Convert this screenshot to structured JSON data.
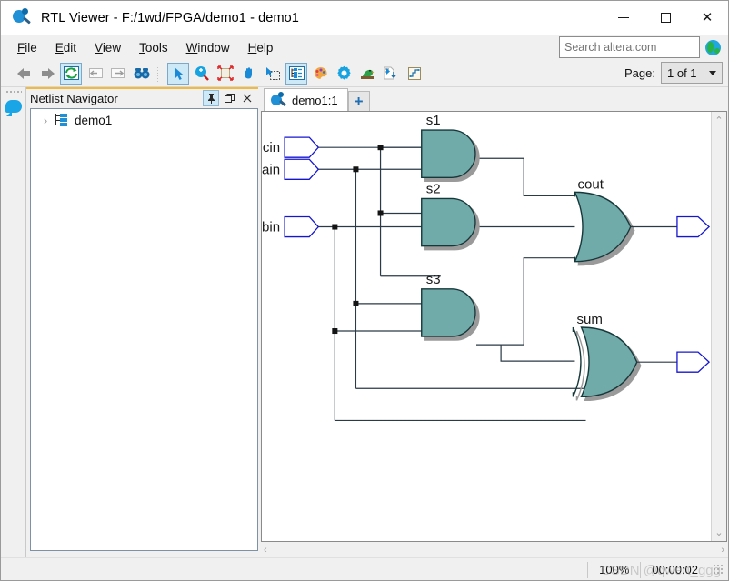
{
  "window": {
    "title": "RTL Viewer - F:/1wd/FPGA/demo1 - demo1",
    "app_icon": "rtl-viewer-icon",
    "minimize_label": "—",
    "maximize_label": "□",
    "close_label": "✕"
  },
  "menu": {
    "items": [
      {
        "label": "File",
        "accel": "F"
      },
      {
        "label": "Edit",
        "accel": "E"
      },
      {
        "label": "View",
        "accel": "V"
      },
      {
        "label": "Tools",
        "accel": "T"
      },
      {
        "label": "Window",
        "accel": "W"
      },
      {
        "label": "Help",
        "accel": "H"
      }
    ]
  },
  "search": {
    "value": "",
    "placeholder": "Search altera.com",
    "icon": "globe-icon"
  },
  "toolbar": {
    "group1": [
      {
        "name": "back-icon",
        "glyph": "⬅",
        "enabled": false,
        "selected": false
      },
      {
        "name": "forward-icon",
        "glyph": "➡",
        "enabled": false,
        "selected": false
      },
      {
        "name": "refresh-icon",
        "glyph": "↺",
        "enabled": true,
        "selected": false
      },
      {
        "name": "previous-page-icon",
        "glyph": "←",
        "enabled": false,
        "selected": false
      },
      {
        "name": "next-page-icon",
        "glyph": "→",
        "enabled": false,
        "selected": false
      },
      {
        "name": "find-icon",
        "glyph": "◉◉",
        "enabled": true,
        "selected": false
      }
    ],
    "group2": [
      {
        "name": "select-tool-icon",
        "glyph": "⬈",
        "selected": true
      },
      {
        "name": "zoom-tool-icon",
        "glyph": "⌕",
        "selected": false
      },
      {
        "name": "fit-in-window-icon",
        "glyph": "⤡",
        "selected": false
      },
      {
        "name": "hand-pan-tool-icon",
        "glyph": "✋",
        "selected": false
      },
      {
        "name": "area-select-tool-icon",
        "glyph": "⬚",
        "selected": false
      },
      {
        "name": "netlist-navigator-icon",
        "glyph": "☰",
        "selected": true
      },
      {
        "name": "color-palette-icon",
        "glyph": "◕",
        "selected": false
      },
      {
        "name": "settings-gear-icon",
        "glyph": "⚙",
        "selected": false
      },
      {
        "name": "bird-probe-icon",
        "glyph": "▶",
        "selected": false
      },
      {
        "name": "export-netlist-icon",
        "glyph": "⬇",
        "selected": false
      },
      {
        "name": "schematic-export-icon",
        "glyph": "☰",
        "selected": false
      }
    ]
  },
  "page_control": {
    "label": "Page:",
    "value": "1 of 1"
  },
  "left_strip": {
    "bubble_icon": "message-bubble-icon"
  },
  "nav_panel": {
    "title": "Netlist Navigator",
    "buttons": [
      {
        "name": "pin-panel-button",
        "glyph": "📌",
        "active": true
      },
      {
        "name": "undock-panel-button",
        "glyph": "❐",
        "active": false
      },
      {
        "name": "close-panel-button",
        "glyph": "✕",
        "active": false
      }
    ],
    "tree": [
      {
        "label": "demo1",
        "expanded": false,
        "arrow": "›",
        "icon": "hierarchy-icon"
      }
    ]
  },
  "tabs": {
    "items": [
      {
        "label": "demo1:1",
        "icon": "rtl-viewer-icon",
        "active": true
      }
    ],
    "add_label": "+"
  },
  "scrollbars": {
    "v_up": "⌃",
    "v_down": "⌄",
    "h_left": "‹",
    "h_right": "›"
  },
  "status": {
    "zoom": "100%",
    "elapsed": "00:00:02",
    "watermark": "CSDN @qwert_ggg"
  },
  "schematic": {
    "inputs": [
      {
        "name": "cin",
        "label": "cin"
      },
      {
        "name": "ain",
        "label": "ain"
      },
      {
        "name": "bin",
        "label": "bin"
      }
    ],
    "gates": [
      {
        "name": "s1",
        "label": "s1",
        "type": "AND"
      },
      {
        "name": "s2",
        "label": "s2",
        "type": "AND"
      },
      {
        "name": "s3",
        "label": "s3",
        "type": "AND"
      },
      {
        "name": "cout",
        "label": "cout",
        "type": "OR"
      },
      {
        "name": "sum",
        "label": "sum",
        "type": "XOR"
      }
    ],
    "outputs": [
      {
        "name": "cout",
        "label": "cout"
      },
      {
        "name": "sum",
        "label": "sum"
      }
    ],
    "colors": {
      "gate_fill": "#6faaa9",
      "gate_stroke": "#1a3a3a",
      "wire": "#2a3a46",
      "pin_stroke": "#1616d0",
      "shadow": "#9a9a9a"
    }
  }
}
